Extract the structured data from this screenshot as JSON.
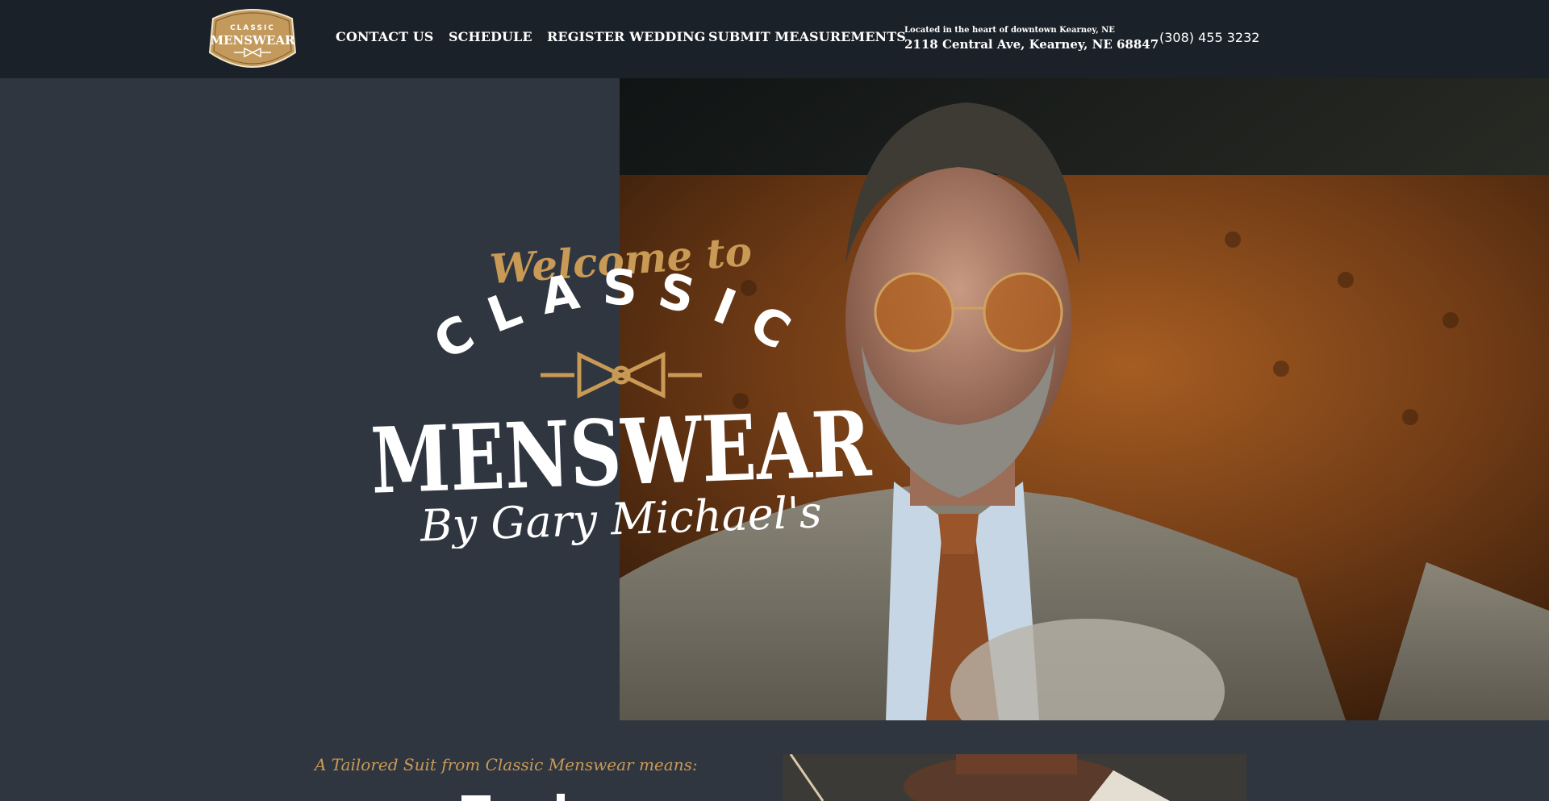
{
  "nav": {
    "logo": {
      "top": "CLASSIC",
      "main": "MENSWEAR"
    },
    "links": [
      "CONTACT US",
      "SCHEDULE",
      "REGISTER WEDDING",
      "SUBMIT MEASUREMENTS"
    ],
    "address_tagline": "Located in the heart of downtown Kearney, NE",
    "address": "2118 Central Ave, Kearney, NE 68847",
    "phone": "(308) 455 3232"
  },
  "hero": {
    "welcome": "Welcome to",
    "classic": "CLASSIC",
    "menswear": "MENSWEAR",
    "byline": "By Gary Michael's"
  },
  "section": {
    "tagline": "A Tailored Suit from Classic Menswear means:"
  },
  "colors": {
    "nav_bg": "#1b2128",
    "page_bg": "#2f3640",
    "accent_gold": "#c99a55"
  }
}
